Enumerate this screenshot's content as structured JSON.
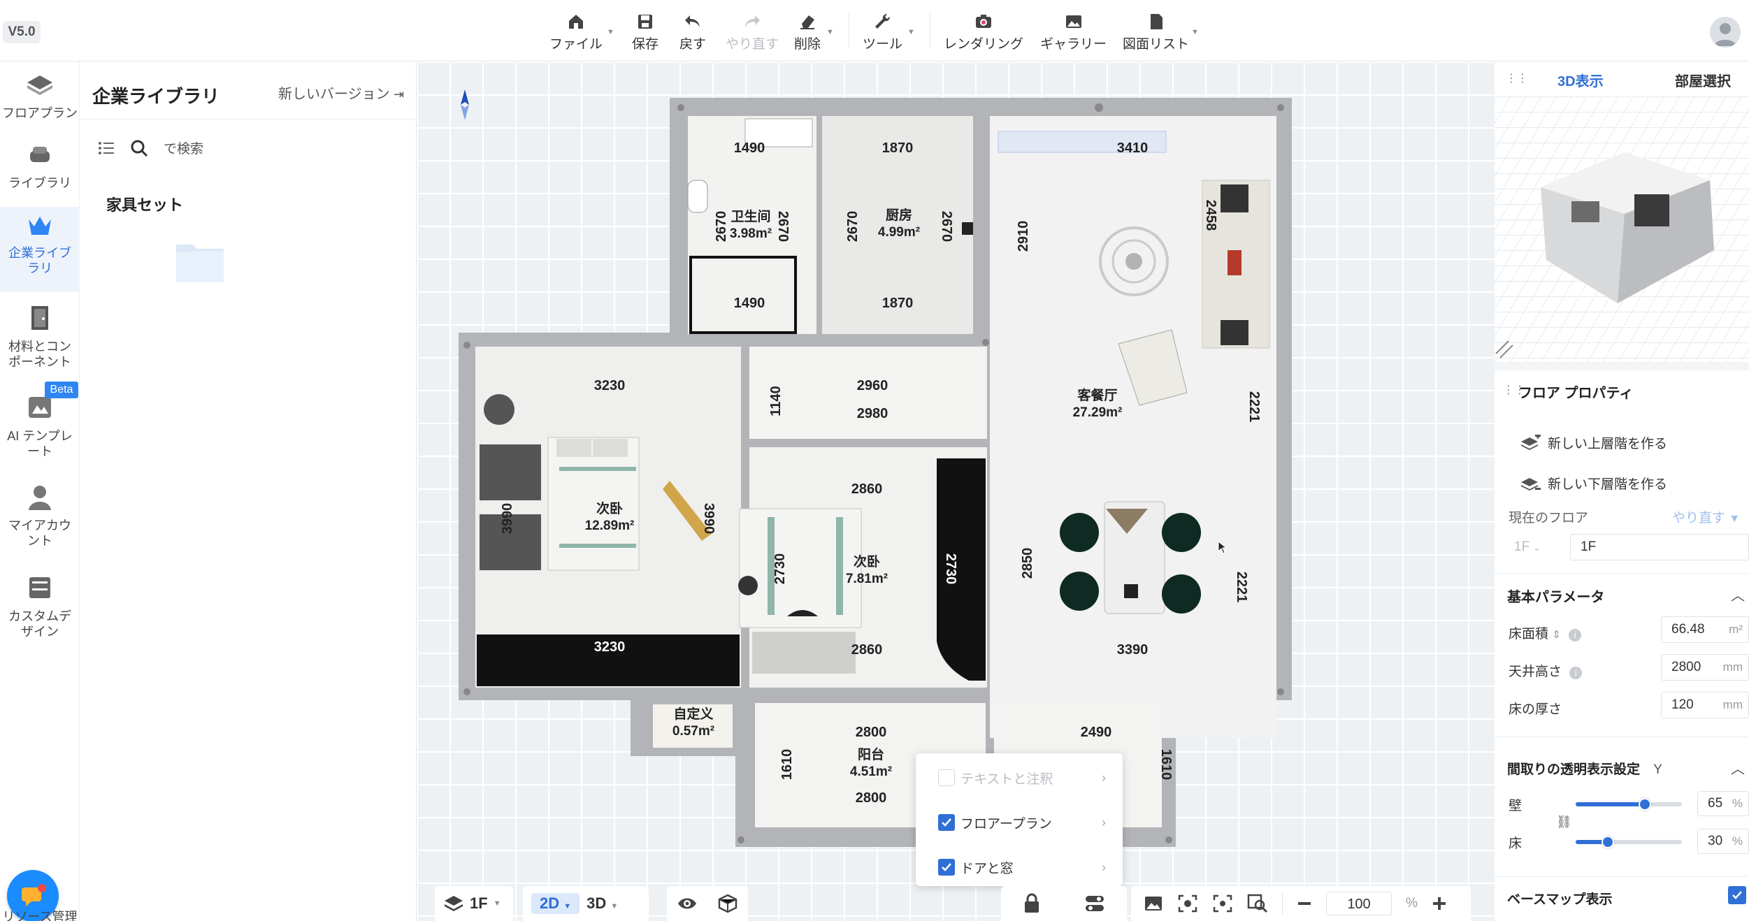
{
  "app": {
    "version": "V5.0"
  },
  "toolbar": {
    "file": "ファイル",
    "save": "保存",
    "undo": "戻す",
    "redo": "やり直す",
    "delete": "削除",
    "tools": "ツール",
    "render": "レンダリング",
    "gallery": "ギャラリー",
    "drawings": "図面リスト"
  },
  "rail": {
    "items": [
      {
        "label": "フロアプラン",
        "icon": "floorplan-icon"
      },
      {
        "label": "ライブラリ",
        "icon": "library-icon"
      },
      {
        "label": "企業ライブラリ",
        "icon": "enterprise-crown-icon"
      },
      {
        "label": "材料とコンポーネント",
        "icon": "door-icon"
      },
      {
        "label": "AI テンプレート",
        "icon": "ai-template-icon"
      },
      {
        "label": "マイアカウント",
        "icon": "user-icon"
      },
      {
        "label": "カスタムデザイン",
        "icon": "cabinet-icon"
      }
    ],
    "beta": "Beta",
    "bottom_label": "リソース管理"
  },
  "library": {
    "title": "企業ライブラリ",
    "new_version": "新しいバージョン",
    "search_placeholder": "で検索",
    "section": "家具セット"
  },
  "plan": {
    "rooms": [
      {
        "name": "卫生间",
        "area": "3.98m²"
      },
      {
        "name": "厨房",
        "area": "4.99m²"
      },
      {
        "name": "客餐厅",
        "area": "27.29m²"
      },
      {
        "name": "次卧",
        "area": "12.89m²"
      },
      {
        "name": "次卧",
        "area": "7.81m²"
      },
      {
        "name": "自定义",
        "area": "0.57m²"
      },
      {
        "name": "阳台",
        "area": "4.51m²"
      }
    ],
    "dims": {
      "bath_top": "1490",
      "bath_bottom": "1490",
      "bath_left": "2670",
      "bath_right": "2670",
      "kitchen_top": "1870",
      "kitchen_bottom": "1870",
      "kitchen_left": "2670",
      "kitchen_right": "2670",
      "kitchen_side": "2910",
      "living_top": "3410",
      "sofa": "2458",
      "living_right_upper": "2221",
      "living_right_lower": "2221",
      "living_bottom": "3390",
      "living_left": "2850",
      "bed1_top": "3230",
      "bed1_bottom": "3230",
      "bed1_left": "3990",
      "bed1_right": "3990",
      "hall_top": "2960",
      "hall_bottom": "2980",
      "hall_left": "1140",
      "bed2_top": "2860",
      "bed2_bottom": "2860",
      "bed2_left": "2730",
      "bed2_right": "2730",
      "balcony_top": "2800",
      "balcony_bottom": "2800",
      "balcony_left": "1610",
      "balcony2_top": "2490",
      "balcony2_right": "1610"
    }
  },
  "popup": {
    "items": [
      {
        "label": "テキストと注釈",
        "checked": false,
        "enabled": false
      },
      {
        "label": "フロアープラン",
        "checked": true,
        "enabled": true
      },
      {
        "label": "ドアと窓",
        "checked": true,
        "enabled": true
      }
    ]
  },
  "bottom": {
    "floor": "1F",
    "view2d": "2D",
    "view3d": "3D",
    "zoom": "100",
    "zoom_unit": "%"
  },
  "right": {
    "tabs": [
      "3D表示",
      "部屋選択"
    ],
    "props_title": "フロア プロパティ",
    "new_upper": "新しい上層階を作る",
    "new_lower": "新しい下層階を作る",
    "current_floor_label": "現在のフロア",
    "redo": "やり直す",
    "floor_select": "1F",
    "floor_name": "1F",
    "basic_title": "基本パラメータ",
    "floor_area_label": "床面積",
    "floor_area": "66.48",
    "floor_area_unit": "m²",
    "ceiling_label": "天井高さ",
    "ceiling": "2800",
    "floor_thick_label": "床の厚さ",
    "floor_thick": "120",
    "mm": "mm",
    "transparency_title": "間取りの透明表示設定",
    "transparency_key": "Y",
    "wall_label": "壁",
    "wall_value": "65",
    "wall_level": 0.65,
    "floor_label": "床",
    "floor_value": "30",
    "floor_level": 0.3,
    "percent": "%",
    "basemap_label": "ベースマップ表示",
    "basemap_checked": true
  }
}
